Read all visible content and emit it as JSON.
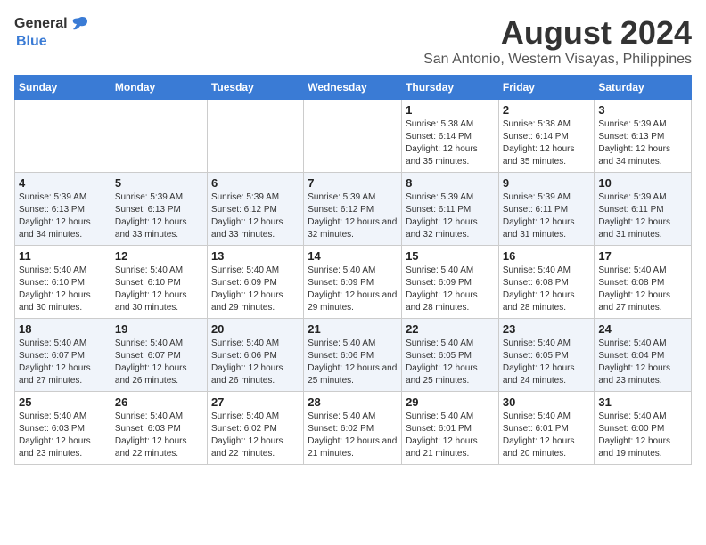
{
  "header": {
    "logo_general": "General",
    "logo_blue": "Blue",
    "month_year": "August 2024",
    "location": "San Antonio, Western Visayas, Philippines"
  },
  "weekdays": [
    "Sunday",
    "Monday",
    "Tuesday",
    "Wednesday",
    "Thursday",
    "Friday",
    "Saturday"
  ],
  "weeks": [
    [
      {
        "day": "",
        "info": ""
      },
      {
        "day": "",
        "info": ""
      },
      {
        "day": "",
        "info": ""
      },
      {
        "day": "",
        "info": ""
      },
      {
        "day": "1",
        "info": "Sunrise: 5:38 AM\nSunset: 6:14 PM\nDaylight: 12 hours and 35 minutes."
      },
      {
        "day": "2",
        "info": "Sunrise: 5:38 AM\nSunset: 6:14 PM\nDaylight: 12 hours and 35 minutes."
      },
      {
        "day": "3",
        "info": "Sunrise: 5:39 AM\nSunset: 6:13 PM\nDaylight: 12 hours and 34 minutes."
      }
    ],
    [
      {
        "day": "4",
        "info": "Sunrise: 5:39 AM\nSunset: 6:13 PM\nDaylight: 12 hours and 34 minutes."
      },
      {
        "day": "5",
        "info": "Sunrise: 5:39 AM\nSunset: 6:13 PM\nDaylight: 12 hours and 33 minutes."
      },
      {
        "day": "6",
        "info": "Sunrise: 5:39 AM\nSunset: 6:12 PM\nDaylight: 12 hours and 33 minutes."
      },
      {
        "day": "7",
        "info": "Sunrise: 5:39 AM\nSunset: 6:12 PM\nDaylight: 12 hours and 32 minutes."
      },
      {
        "day": "8",
        "info": "Sunrise: 5:39 AM\nSunset: 6:11 PM\nDaylight: 12 hours and 32 minutes."
      },
      {
        "day": "9",
        "info": "Sunrise: 5:39 AM\nSunset: 6:11 PM\nDaylight: 12 hours and 31 minutes."
      },
      {
        "day": "10",
        "info": "Sunrise: 5:39 AM\nSunset: 6:11 PM\nDaylight: 12 hours and 31 minutes."
      }
    ],
    [
      {
        "day": "11",
        "info": "Sunrise: 5:40 AM\nSunset: 6:10 PM\nDaylight: 12 hours and 30 minutes."
      },
      {
        "day": "12",
        "info": "Sunrise: 5:40 AM\nSunset: 6:10 PM\nDaylight: 12 hours and 30 minutes."
      },
      {
        "day": "13",
        "info": "Sunrise: 5:40 AM\nSunset: 6:09 PM\nDaylight: 12 hours and 29 minutes."
      },
      {
        "day": "14",
        "info": "Sunrise: 5:40 AM\nSunset: 6:09 PM\nDaylight: 12 hours and 29 minutes."
      },
      {
        "day": "15",
        "info": "Sunrise: 5:40 AM\nSunset: 6:09 PM\nDaylight: 12 hours and 28 minutes."
      },
      {
        "day": "16",
        "info": "Sunrise: 5:40 AM\nSunset: 6:08 PM\nDaylight: 12 hours and 28 minutes."
      },
      {
        "day": "17",
        "info": "Sunrise: 5:40 AM\nSunset: 6:08 PM\nDaylight: 12 hours and 27 minutes."
      }
    ],
    [
      {
        "day": "18",
        "info": "Sunrise: 5:40 AM\nSunset: 6:07 PM\nDaylight: 12 hours and 27 minutes."
      },
      {
        "day": "19",
        "info": "Sunrise: 5:40 AM\nSunset: 6:07 PM\nDaylight: 12 hours and 26 minutes."
      },
      {
        "day": "20",
        "info": "Sunrise: 5:40 AM\nSunset: 6:06 PM\nDaylight: 12 hours and 26 minutes."
      },
      {
        "day": "21",
        "info": "Sunrise: 5:40 AM\nSunset: 6:06 PM\nDaylight: 12 hours and 25 minutes."
      },
      {
        "day": "22",
        "info": "Sunrise: 5:40 AM\nSunset: 6:05 PM\nDaylight: 12 hours and 25 minutes."
      },
      {
        "day": "23",
        "info": "Sunrise: 5:40 AM\nSunset: 6:05 PM\nDaylight: 12 hours and 24 minutes."
      },
      {
        "day": "24",
        "info": "Sunrise: 5:40 AM\nSunset: 6:04 PM\nDaylight: 12 hours and 23 minutes."
      }
    ],
    [
      {
        "day": "25",
        "info": "Sunrise: 5:40 AM\nSunset: 6:03 PM\nDaylight: 12 hours and 23 minutes."
      },
      {
        "day": "26",
        "info": "Sunrise: 5:40 AM\nSunset: 6:03 PM\nDaylight: 12 hours and 22 minutes."
      },
      {
        "day": "27",
        "info": "Sunrise: 5:40 AM\nSunset: 6:02 PM\nDaylight: 12 hours and 22 minutes."
      },
      {
        "day": "28",
        "info": "Sunrise: 5:40 AM\nSunset: 6:02 PM\nDaylight: 12 hours and 21 minutes."
      },
      {
        "day": "29",
        "info": "Sunrise: 5:40 AM\nSunset: 6:01 PM\nDaylight: 12 hours and 21 minutes."
      },
      {
        "day": "30",
        "info": "Sunrise: 5:40 AM\nSunset: 6:01 PM\nDaylight: 12 hours and 20 minutes."
      },
      {
        "day": "31",
        "info": "Sunrise: 5:40 AM\nSunset: 6:00 PM\nDaylight: 12 hours and 19 minutes."
      }
    ]
  ]
}
